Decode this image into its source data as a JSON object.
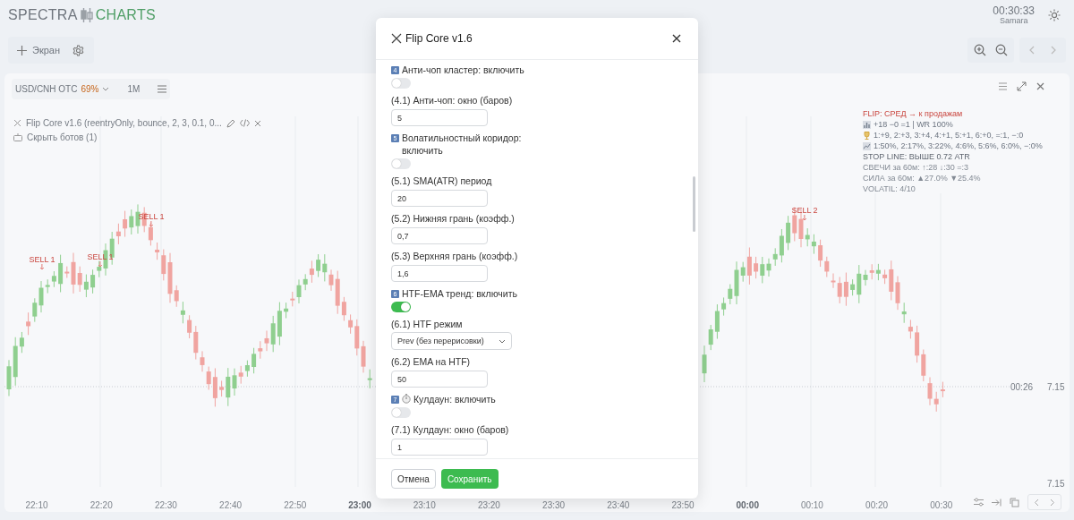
{
  "header": {
    "logo_left": "SPECTRA",
    "logo_right": "CHARTS",
    "clock": "00:30:33",
    "timezone": "Samara"
  },
  "toolbar": {
    "add_screen": "Экран"
  },
  "chart": {
    "symbol": "USD/CNH OTC",
    "payout": "69%",
    "timeframe": "1M",
    "bot_label": "Flip Core v1.6 (reentryOnly, bounce, 2, 3, 0.1, 0...",
    "hide_bots": "Скрыть ботов (1)",
    "signals": [
      {
        "label": "SELL 1"
      },
      {
        "label": "SELL 1"
      },
      {
        "label": "SELL 1"
      },
      {
        "label": "SELL 2"
      }
    ],
    "info_lines": [
      {
        "kind": "signal",
        "text": "FLIP: СРЕД → к продажам"
      },
      {
        "kind": "score",
        "text": "+18 −0 =1 | WR 100%"
      },
      {
        "kind": "wins",
        "text": "1:+9, 2:+3, 3:+4, 4:+1, 5:+1, 6:+0, =:1, −:0"
      },
      {
        "kind": "shares",
        "text": "1:50%, 2:17%, 3:22%, 4:6%, 5:6%, 6:0%, −:0%"
      },
      {
        "kind": "stop",
        "text": "STOP LINE: ВЫШЕ 0.72 ATR"
      },
      {
        "kind": "muted",
        "text": "СВЕЧИ за 60м: ↑:28 ↓:30 =:3"
      },
      {
        "kind": "muted",
        "text": "СИЛА за 60м: ▲27.0% ▼25.4%"
      },
      {
        "kind": "muted",
        "text": "VOLATIL: 4/10"
      }
    ],
    "time_axis": [
      {
        "label": "22:10",
        "bold": false
      },
      {
        "label": "22:20",
        "bold": false
      },
      {
        "label": "22:30",
        "bold": false
      },
      {
        "label": "22:40",
        "bold": false
      },
      {
        "label": "22:50",
        "bold": false
      },
      {
        "label": "23:00",
        "bold": true
      },
      {
        "label": "23:10",
        "bold": false
      },
      {
        "label": "23:20",
        "bold": false
      },
      {
        "label": "23:30",
        "bold": false
      },
      {
        "label": "23:40",
        "bold": false
      },
      {
        "label": "23:50",
        "bold": false
      },
      {
        "label": "00:00",
        "bold": true
      },
      {
        "label": "00:10",
        "bold": false
      },
      {
        "label": "00:20",
        "bold": false
      },
      {
        "label": "00:30",
        "bold": false
      }
    ],
    "last_time": "00:26",
    "last_price": "7.15",
    "low_price": "7.15"
  },
  "modal": {
    "title": "Flip Core v1.6",
    "fields": [
      {
        "kind": "toggle",
        "badge": "4",
        "label": "Анти-чоп кластер: включить",
        "on": false
      },
      {
        "kind": "number",
        "label": "(4.1) Анти-чоп: окно (баров)",
        "value": "5"
      },
      {
        "kind": "toggle",
        "badge": "5",
        "label": "Волатильностный коридор: включить",
        "on": false
      },
      {
        "kind": "number",
        "label": "(5.1) SMA(ATR) период",
        "value": "20"
      },
      {
        "kind": "number",
        "label": "(5.2) Нижняя грань (коэфф.)",
        "value": "0,7"
      },
      {
        "kind": "number",
        "label": "(5.3) Верхняя грань (коэфф.)",
        "value": "1,6"
      },
      {
        "kind": "toggle",
        "badge": "6",
        "label": "HTF-EMA тренд: включить",
        "on": true
      },
      {
        "kind": "select",
        "label": "(6.1) HTF режим",
        "value": "Prev (без перерисовки)"
      },
      {
        "kind": "number",
        "label": "(6.2) EMA на HTF)",
        "value": "50"
      },
      {
        "kind": "toggle",
        "badge": "7",
        "timer": true,
        "label": "Кулдаун: включить",
        "on": false
      },
      {
        "kind": "number",
        "label": "(7.1) Кулдаун: окно (баров)",
        "value": "1"
      }
    ],
    "cancel": "Отмена",
    "save": "Сохранить"
  }
}
